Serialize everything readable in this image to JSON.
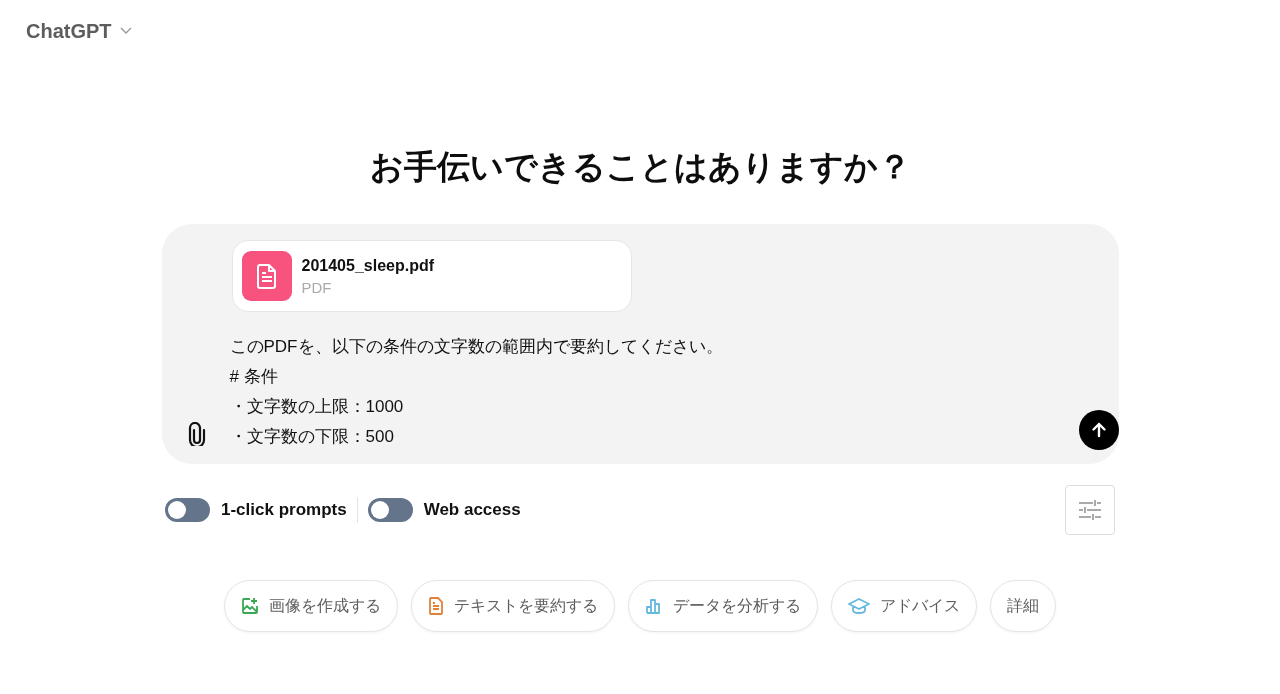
{
  "header": {
    "model_name": "ChatGPT"
  },
  "heading": "お手伝いできることはありますか？",
  "composer": {
    "attachment": {
      "file_name": "201405_sleep.pdf",
      "file_type": "PDF"
    },
    "message_lines": [
      "このPDFを、以下の条件の文字数の範囲内で要約してください。",
      "# 条件",
      "・文字数の上限：1000",
      "・文字数の下限：500"
    ]
  },
  "toggles": [
    {
      "label": "1-click prompts",
      "on": false
    },
    {
      "label": "Web access",
      "on": false
    }
  ],
  "suggestions": [
    {
      "kind": "image",
      "label": "画像を作成する"
    },
    {
      "kind": "text",
      "label": "テキストを要約する"
    },
    {
      "kind": "data",
      "label": "データを分析する"
    },
    {
      "kind": "advice",
      "label": "アドバイス"
    },
    {
      "kind": "more",
      "label": "詳細"
    }
  ]
}
